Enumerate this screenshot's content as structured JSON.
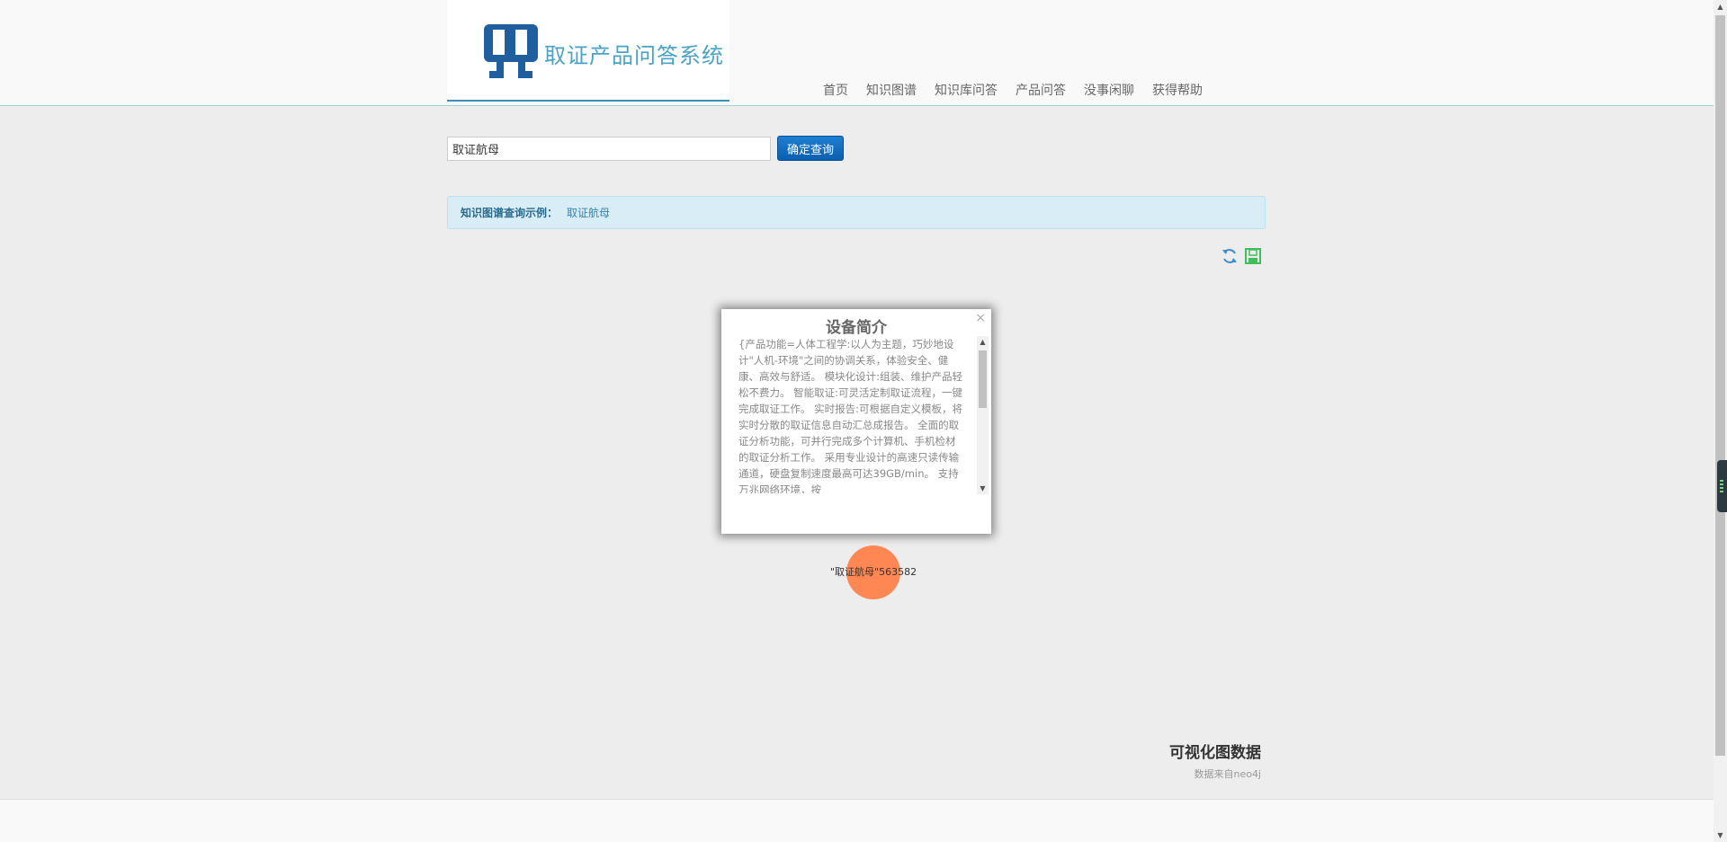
{
  "header": {
    "logo_text": "取证产品问答系统",
    "nav": [
      "首页",
      "知识图谱",
      "知识库问答",
      "产品问答",
      "没事闲聊",
      "获得帮助"
    ]
  },
  "search": {
    "value": "取证航母",
    "button_label": "确定查询"
  },
  "example": {
    "label": "知识图谱查询示例：",
    "link": "取证航母"
  },
  "tools": {
    "refresh_icon": "refresh-icon",
    "save_icon": "save-icon"
  },
  "popup": {
    "title": "设备简介",
    "close": "×",
    "body": "{产品功能=人体工程学:以人为主题，巧妙地设计\"人机-环境\"之间的协调关系，体验安全、健康、高效与舒适。 模块化设计:组装、维护产品轻松不费力。 智能取证:可灵活定制取证流程，一键完成取证工作。 实时报告:可根据自定义模板，将实时分散的取证信息自动汇总成报告。 全面的取证分析功能，可并行完成多个计算机、手机检材的取证分析工作。 采用专业设计的高速只读传输通道，硬盘复制速度最高可达39GB/min。 支持万兆网络环境，按"
  },
  "graph": {
    "node_label": "\"取证航母\"563582",
    "node_color": "#ff8754"
  },
  "visualization": {
    "title": "可视化图数据",
    "subtitle": "数据来自neo4j"
  },
  "colors": {
    "accent": "#0a5fb0",
    "logo_blue": "#1f5f9e",
    "logo_text": "#4aa3c4",
    "example_bg": "#d9edf6"
  }
}
